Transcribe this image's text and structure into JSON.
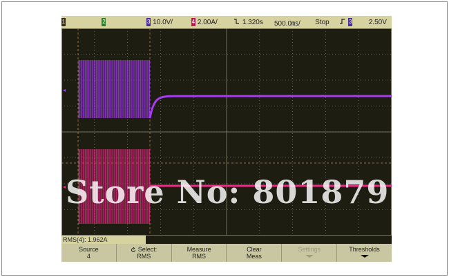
{
  "statusbar": {
    "ch1_marker": "1",
    "ch2_marker": "2",
    "ch3_marker": "3",
    "ch3_scale": "10.0V/",
    "ch4_marker": "4",
    "ch4_scale": "2.00A/",
    "trigger_slope_icon": "falling-edge-icon",
    "time_offset": "1.320s",
    "time_scale": "500.0㎳/",
    "run_state": "Stop",
    "trigger_icon": "rising-edge-icon",
    "trigger_source": "3",
    "trigger_level": "2.50V"
  },
  "measurement": {
    "readout": "RMS(4): 1.962A"
  },
  "softkeys": [
    {
      "line1": "Source",
      "line2": "4"
    },
    {
      "line1": "Select:",
      "line2": "RMS"
    },
    {
      "line1": "Measure",
      "line2": "RMS"
    },
    {
      "line1": "Clear",
      "line2": "Meas"
    },
    {
      "line1": "Settings",
      "line2": ""
    },
    {
      "line1": "Thresholds",
      "line2": ""
    }
  ],
  "watermark": "Store No: 801879",
  "colors": {
    "ch3": "#a53cf0",
    "ch4": "#ef2a86",
    "grid": "#8d8d78",
    "background": "#1d1d12",
    "chrome": "#d6d3a0"
  }
}
